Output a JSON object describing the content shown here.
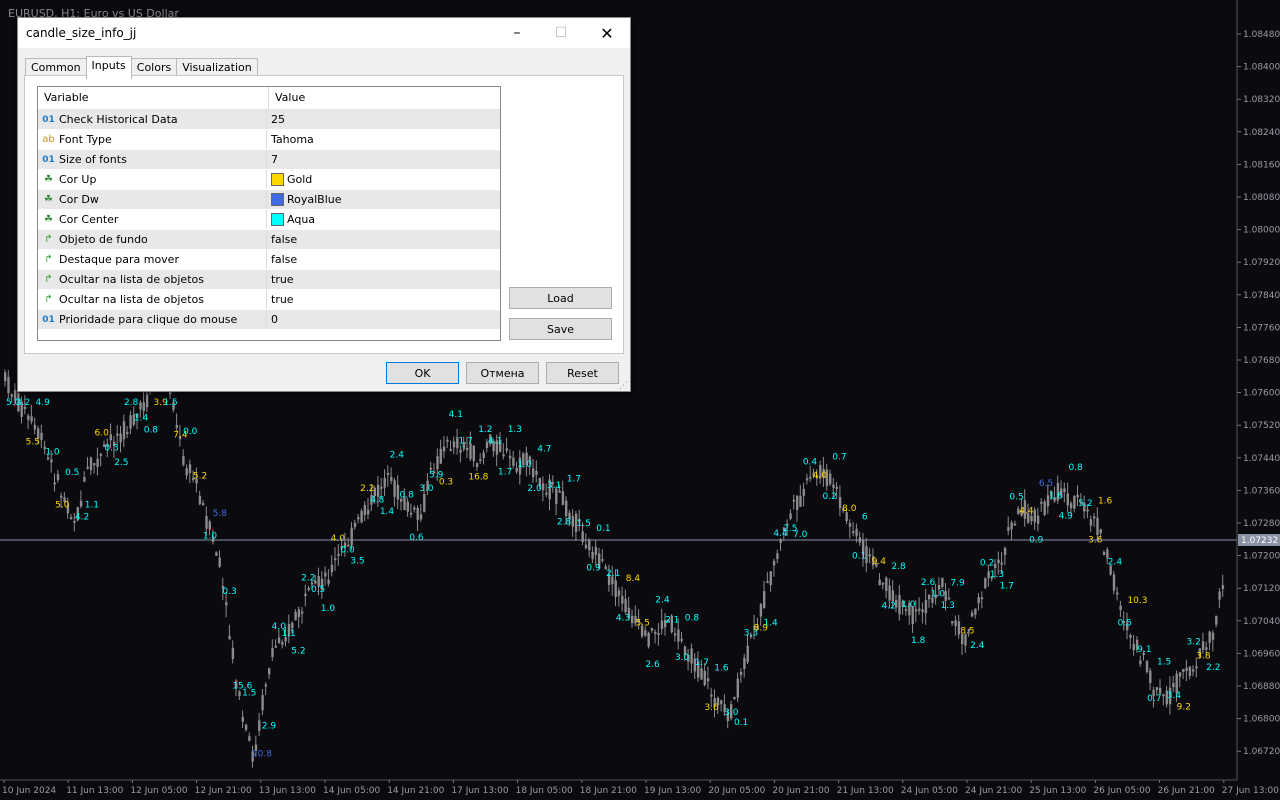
{
  "window": {
    "title": "EURUSD, H1: Euro vs US Dollar"
  },
  "colors": {
    "bg": "#0a0a0f",
    "grid": "#1e1e28",
    "axis": "#9a9aa6",
    "candle": "#8c8c8c",
    "up": "#FFD700",
    "dw": "#4169E1",
    "center": "#00FFFF",
    "line": "#8a93a6"
  },
  "price_axis": {
    "labels": [
      "1.08480",
      "1.08400",
      "1.08320",
      "1.08240",
      "1.08160",
      "1.08080",
      "1.08000",
      "1.07920",
      "1.07840",
      "1.07760",
      "1.07680",
      "1.07600",
      "1.07520",
      "1.07440",
      "1.07360",
      "1.07280",
      "1.07200",
      "1.07120",
      "1.07040",
      "1.06960",
      "1.06880",
      "1.06800",
      "1.06720"
    ],
    "current": "1.07232"
  },
  "time_axis": {
    "labels": [
      "10 Jun 2024",
      "11 Jun 13:00",
      "12 Jun 05:00",
      "12 Jun 21:00",
      "13 Jun 13:00",
      "14 Jun 05:00",
      "14 Jun 21:00",
      "17 Jun 13:00",
      "18 Jun 05:00",
      "18 Jun 21:00",
      "19 Jun 13:00",
      "20 Jun 05:00",
      "20 Jun 21:00",
      "21 Jun 13:00",
      "24 Jun 05:00",
      "24 Jun 21:00",
      "25 Jun 13:00",
      "26 Jun 05:00",
      "26 Jun 21:00",
      "27 Jun 13:00"
    ]
  },
  "chart_labels": [
    {
      "t": "5.0",
      "c": "center"
    },
    {
      "t": "3.2",
      "c": "center"
    },
    {
      "t": "5.5",
      "c": "up"
    },
    {
      "t": "4.9",
      "c": "center"
    },
    {
      "t": "1.0",
      "c": "center"
    },
    {
      "t": "5.0",
      "c": "up"
    },
    {
      "t": "0.5",
      "c": "center"
    },
    {
      "t": "4.2",
      "c": "center"
    },
    {
      "t": "1.1",
      "c": "center"
    },
    {
      "t": "6.0",
      "c": "up"
    },
    {
      "t": "0.3",
      "c": "center"
    },
    {
      "t": "2.5",
      "c": "center"
    },
    {
      "t": "2.8",
      "c": "center"
    },
    {
      "t": "1.4",
      "c": "center"
    },
    {
      "t": "0.8",
      "c": "center"
    },
    {
      "t": "3.9",
      "c": "up"
    },
    {
      "t": "1.5",
      "c": "center"
    },
    {
      "t": "7.4",
      "c": "up"
    },
    {
      "t": "0.0",
      "c": "center"
    },
    {
      "t": "5.2",
      "c": "up"
    },
    {
      "t": "1.0",
      "c": "center"
    },
    {
      "t": "5.8",
      "c": "dw"
    },
    {
      "t": "0.3",
      "c": "center"
    },
    {
      "t": "15.6",
      "c": "center"
    },
    {
      "t": "1.5",
      "c": "center"
    },
    {
      "t": "20.8",
      "c": "dw"
    },
    {
      "t": "2.9",
      "c": "center"
    },
    {
      "t": "4.0",
      "c": "center"
    },
    {
      "t": "1.1",
      "c": "center"
    },
    {
      "t": "5.2",
      "c": "center"
    },
    {
      "t": "2.2",
      "c": "center"
    },
    {
      "t": "0.5",
      "c": "center"
    },
    {
      "t": "1.0",
      "c": "center"
    },
    {
      "t": "4.0",
      "c": "up"
    },
    {
      "t": "0.0",
      "c": "center"
    },
    {
      "t": "3.5",
      "c": "center"
    },
    {
      "t": "2.2",
      "c": "up"
    },
    {
      "t": "4.8",
      "c": "center"
    },
    {
      "t": "1.4",
      "c": "center"
    },
    {
      "t": "2.4",
      "c": "center"
    },
    {
      "t": "0.8",
      "c": "center"
    },
    {
      "t": "0.6",
      "c": "center"
    },
    {
      "t": "3.0",
      "c": "center"
    },
    {
      "t": "5.9",
      "c": "center"
    },
    {
      "t": "0.3",
      "c": "up"
    },
    {
      "t": "4.1",
      "c": "center"
    },
    {
      "t": "1.7",
      "c": "center"
    },
    {
      "t": "16.8",
      "c": "up"
    },
    {
      "t": "1.2",
      "c": "center"
    },
    {
      "t": "4.1",
      "c": "center"
    },
    {
      "t": "1.7",
      "c": "center"
    },
    {
      "t": "1.3",
      "c": "center"
    },
    {
      "t": "1.0",
      "c": "center"
    },
    {
      "t": "2.0",
      "c": "center"
    },
    {
      "t": "4.7",
      "c": "center"
    },
    {
      "t": "3.1",
      "c": "center"
    },
    {
      "t": "2.8",
      "c": "center"
    },
    {
      "t": "1.7",
      "c": "center"
    },
    {
      "t": "1.5",
      "c": "center"
    },
    {
      "t": "0.9",
      "c": "center"
    },
    {
      "t": "0.1",
      "c": "center"
    },
    {
      "t": "2.1",
      "c": "center"
    },
    {
      "t": "4.3",
      "c": "center"
    },
    {
      "t": "8.4",
      "c": "up"
    },
    {
      "t": "5.5",
      "c": "up"
    },
    {
      "t": "2.6",
      "c": "center"
    },
    {
      "t": "2.4",
      "c": "center"
    },
    {
      "t": "2.1",
      "c": "center"
    },
    {
      "t": "3.0",
      "c": "center"
    },
    {
      "t": "0.8",
      "c": "center"
    },
    {
      "t": "1.7",
      "c": "center"
    },
    {
      "t": "3.6",
      "c": "up"
    },
    {
      "t": "1.6",
      "c": "center"
    },
    {
      "t": "3.0",
      "c": "center"
    },
    {
      "t": "0.1",
      "c": "center"
    },
    {
      "t": "3.3",
      "c": "center"
    },
    {
      "t": "8.9",
      "c": "up"
    },
    {
      "t": "1.4",
      "c": "center"
    },
    {
      "t": "4.4",
      "c": "center"
    },
    {
      "t": "2.5",
      "c": "center"
    },
    {
      "t": "7.0",
      "c": "center"
    },
    {
      "t": "0.4",
      "c": "center"
    },
    {
      "t": "4.0",
      "c": "up"
    },
    {
      "t": "0.2",
      "c": "center"
    },
    {
      "t": "0.7",
      "c": "center"
    },
    {
      "t": "8.0",
      "c": "up"
    },
    {
      "t": "0.1",
      "c": "center"
    },
    {
      "t": "6",
      "c": "center"
    },
    {
      "t": "9.4",
      "c": "up"
    },
    {
      "t": "4.2",
      "c": "center"
    },
    {
      "t": "2.8",
      "c": "center"
    },
    {
      "t": "1.0",
      "c": "center"
    },
    {
      "t": "1.8",
      "c": "center"
    },
    {
      "t": "2.6",
      "c": "center"
    },
    {
      "t": "1.0",
      "c": "center"
    },
    {
      "t": "1.3",
      "c": "center"
    },
    {
      "t": "7.9",
      "c": "center"
    },
    {
      "t": "8.5",
      "c": "up"
    },
    {
      "t": "2.4",
      "c": "center"
    },
    {
      "t": "0.2",
      "c": "center"
    },
    {
      "t": "1.3",
      "c": "center"
    },
    {
      "t": "1.7",
      "c": "center"
    },
    {
      "t": "0.5",
      "c": "center"
    },
    {
      "t": "4.4",
      "c": "up"
    },
    {
      "t": "0.9",
      "c": "center"
    },
    {
      "t": "6.5",
      "c": "dw"
    },
    {
      "t": "1.6",
      "c": "center"
    },
    {
      "t": "4.9",
      "c": "center"
    },
    {
      "t": "0.8",
      "c": "center"
    },
    {
      "t": "5.2",
      "c": "center"
    },
    {
      "t": "3.6",
      "c": "up"
    },
    {
      "t": "1.6",
      "c": "up"
    },
    {
      "t": "2.4",
      "c": "center"
    },
    {
      "t": "0.5",
      "c": "center"
    },
    {
      "t": "10.3",
      "c": "up"
    },
    {
      "t": "9.1",
      "c": "center"
    },
    {
      "t": "0.7",
      "c": "center"
    },
    {
      "t": "1.5",
      "c": "center"
    },
    {
      "t": "3.4",
      "c": "center"
    },
    {
      "t": "9.2",
      "c": "up"
    },
    {
      "t": "3.2",
      "c": "center"
    },
    {
      "t": "3.8",
      "c": "up"
    },
    {
      "t": "2.2",
      "c": "center"
    }
  ],
  "dialog": {
    "title": "candle_size_info_jj",
    "tabs": [
      "Common",
      "Inputs",
      "Colors",
      "Visualization"
    ],
    "headers": {
      "variable": "Variable",
      "value": "Value"
    },
    "rows": [
      {
        "icon": "01",
        "variable": "Check Historical Data",
        "value": "25"
      },
      {
        "icon": "ab",
        "variable": "Font Type",
        "value": "Tahoma"
      },
      {
        "icon": "01",
        "variable": "Size of fonts",
        "value": "7"
      },
      {
        "icon": "color",
        "variable": "Cor Up",
        "value": "Gold",
        "swatch": "#FFD700"
      },
      {
        "icon": "color",
        "variable": "Cor Dw",
        "value": "RoyalBlue",
        "swatch": "#4169E1"
      },
      {
        "icon": "color",
        "variable": "Cor Center",
        "value": "Aqua",
        "swatch": "#00FFFF"
      },
      {
        "icon": "flag",
        "variable": "Objeto de fundo",
        "value": "false"
      },
      {
        "icon": "flag",
        "variable": "Destaque para mover",
        "value": "false"
      },
      {
        "icon": "flag",
        "variable": "Ocultar na lista de objetos",
        "value": "true"
      },
      {
        "icon": "flag",
        "variable": "Ocultar na lista de objetos",
        "value": "true"
      },
      {
        "icon": "01",
        "variable": "Prioridade para clique do mouse",
        "value": "0"
      }
    ],
    "buttons": {
      "load": "Load",
      "save": "Save",
      "ok": "OK",
      "cancel": "Отмена",
      "reset": "Reset"
    }
  }
}
